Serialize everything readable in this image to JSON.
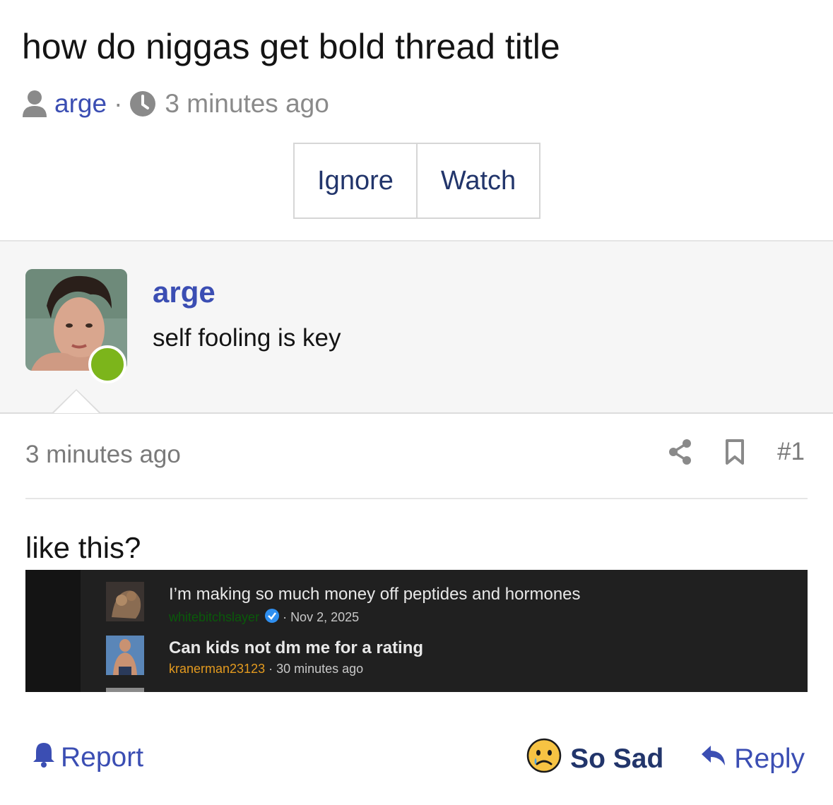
{
  "thread": {
    "title": "how do niggas get bold thread title",
    "author": "arge",
    "separator": "·",
    "time": "3 minutes ago"
  },
  "buttons": {
    "ignore": "Ignore",
    "watch": "Watch"
  },
  "post": {
    "username": "arge",
    "user_title": "self fooling is key",
    "date": "3 minutes ago",
    "number": "#1",
    "body": "like this?",
    "online_color": "#7cb51b"
  },
  "embed": {
    "threads": [
      {
        "title": "I’m making so much money off peptides and hormones",
        "author": "whitebitchslayer",
        "verified": true,
        "sep": "·",
        "date": "Nov 2, 2025"
      },
      {
        "title": "Can kids not dm me for a rating",
        "author": "kranerman23123",
        "sep": "·",
        "date": "30 minutes ago"
      }
    ]
  },
  "footer": {
    "report": "Report",
    "reaction": "So Sad",
    "reply": "Reply"
  },
  "colors": {
    "link": "#3b4eb3",
    "button_text": "#22356b",
    "muted": "#8a8a8a"
  },
  "icons": [
    "user-icon",
    "clock-icon",
    "share-icon",
    "bookmark-icon",
    "bell-icon",
    "sad-emoji-icon",
    "reply-icon",
    "verified-icon"
  ]
}
